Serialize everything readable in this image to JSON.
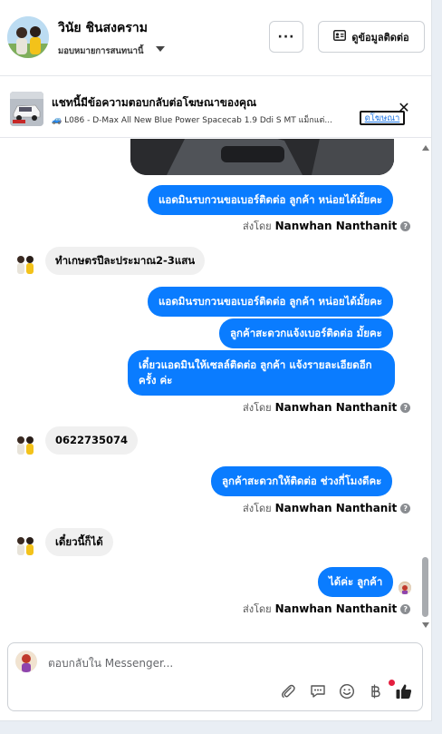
{
  "header": {
    "contact_name": "วินัย ชินสงคราม",
    "assign_label": "มอบหมายการสนทนานี้",
    "more_label": "···",
    "contact_info_label": "ดูข้อมูลติดต่อ"
  },
  "ad": {
    "title": "แชทนี้มีข้อความตอบกลับต่อโฆษณาของคุณ",
    "subtitle": "🚙 L086 - D-Max All New Blue Power Spacecab 1.9 Ddi S MT แม็กแต่...",
    "link_label": "ดโฆษณา",
    "close_label": "✕"
  },
  "messages": {
    "m1": "แอดมินรบกวนขอเบอร์ติดต่อ ลูกค้า หน่อยได้มั้ยคะ",
    "in1": "ทำเกษตรปีละประมาณ2-3แสน",
    "m2": "แอดมินรบกวนขอเบอร์ติดต่อ ลูกค้า หน่อยได้มั้ยคะ",
    "m3": "ลูกค้าสะดวกแจ้งเบอร์ติดต่อ มั้ยคะ",
    "m4_line1": "เดี๋ยวแอดมินให้เซลล์ติดต่อ ลูกค้า แจ้งรายละเอียดอีก",
    "m4_line2": "ครั้ง ค่ะ",
    "in2": "0622735074",
    "m5": "ลูกค้าสะดวกให้ติดต่อ ช่วงกี่โมงดีคะ",
    "in3": "เดี๋ยวนี้ก็ได้",
    "m6": "ได้ค่ะ ลูกค้า"
  },
  "sent_by": {
    "prefix": "ส่งโดย",
    "name": "Nanwhan Nanthanit",
    "help": "?"
  },
  "composer": {
    "placeholder": "ตอบกลับใน Messenger..."
  },
  "icons": [
    "paperclip-icon",
    "saved-reply-icon",
    "emoji-icon",
    "baht-icon",
    "like-icon"
  ],
  "colors": {
    "outgoing": "#0a7cff",
    "incoming": "#f0f0f0",
    "badge": "#e41e3f"
  }
}
